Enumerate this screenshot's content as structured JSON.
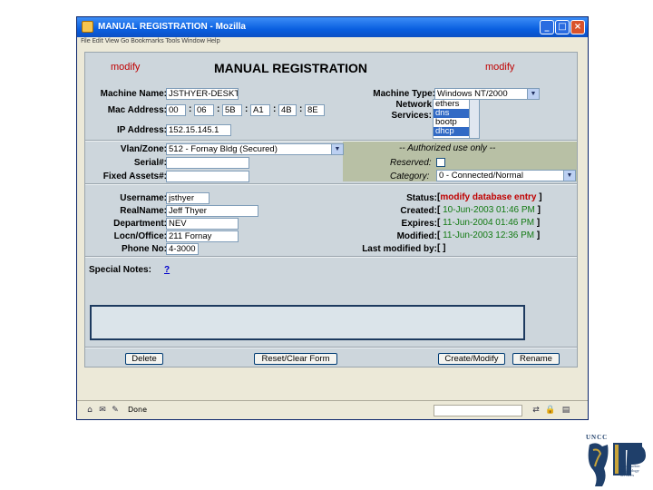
{
  "window": {
    "title": "MANUAL REGISTRATION - Mozilla",
    "menu_text": "File  Edit  View  Go  Bookmarks  Tools  Window  Help",
    "status_text": "Done"
  },
  "header": {
    "left_mode": "modify",
    "title": "MANUAL REGISTRATION",
    "right_mode": "modify"
  },
  "machine": {
    "name_label": "Machine Name:",
    "name_value": "JSTHYER-DESKTOP",
    "mac_label": "Mac Address:",
    "mac": [
      "00",
      "06",
      "5B",
      "A1",
      "4B",
      "8E"
    ],
    "ip_label": "IP Address:",
    "ip_value": "152.15.145.1",
    "type_label": "Machine Type:",
    "type_value": "Windows NT/2000",
    "network_label": "Network",
    "services_label": "Services:",
    "services": [
      "ethers",
      "dns",
      "bootp",
      "dhcp"
    ],
    "services_selected": [
      "dns",
      "dhcp"
    ]
  },
  "location": {
    "vlan_label": "Vlan/Zone:",
    "vlan_value": "512 - Fornay Bldg (Secured)",
    "serial_label": "Serial#:",
    "serial_value": "",
    "assets_label": "Fixed Assets#:",
    "assets_value": "",
    "authorized_text": "-- Authorized use only --",
    "reserved_label": "Reserved:",
    "category_label": "Category:",
    "category_value": "0 - Connected/Normal"
  },
  "user": {
    "username_label": "Username:",
    "username_value": "jsthyer",
    "realname_label": "RealName:",
    "realname_value": "Jeff Thyer",
    "department_label": "Department:",
    "department_value": "NEV",
    "office_label": "Locn/Office:",
    "office_value": "211 Fornay",
    "phone_label": "Phone No:",
    "phone_value": "4-3000"
  },
  "status": {
    "status_label": "Status:",
    "status_value": "modify database entry",
    "created_label": "Created:",
    "created_value": "10-Jun-2003 01:46 PM",
    "expires_label": "Expires:",
    "expires_value": "11-Jun-2004 01:46 PM",
    "modified_label": "Modified:",
    "modified_value": "11-Jun-2003 12:36 PM",
    "last_modified_label": "Last modified by:",
    "last_modified_value": ""
  },
  "notes": {
    "label": "Special Notes:",
    "help_link": "?"
  },
  "buttons": {
    "delete": "Delete",
    "reset": "Reset/Clear Form",
    "create": "Create/Modify",
    "rename": "Rename"
  },
  "logo": {
    "top_text": "UNCC",
    "script_text": "Information Technology Services"
  },
  "colors": {
    "title_bar": "#0a5fe0",
    "form_background": "#cdd6dc",
    "mode_red": "#c00000",
    "date_green": "#127a12",
    "selection_blue": "#316ac5"
  }
}
